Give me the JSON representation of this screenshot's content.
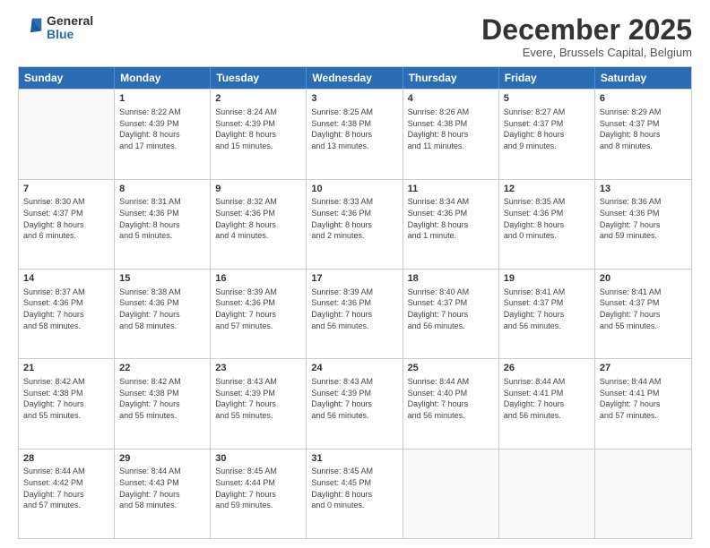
{
  "logo": {
    "general": "General",
    "blue": "Blue"
  },
  "header": {
    "month": "December 2025",
    "location": "Evere, Brussels Capital, Belgium"
  },
  "weekdays": [
    "Sunday",
    "Monday",
    "Tuesday",
    "Wednesday",
    "Thursday",
    "Friday",
    "Saturday"
  ],
  "rows": [
    [
      {
        "day": "",
        "info": ""
      },
      {
        "day": "1",
        "info": "Sunrise: 8:22 AM\nSunset: 4:39 PM\nDaylight: 8 hours\nand 17 minutes."
      },
      {
        "day": "2",
        "info": "Sunrise: 8:24 AM\nSunset: 4:39 PM\nDaylight: 8 hours\nand 15 minutes."
      },
      {
        "day": "3",
        "info": "Sunrise: 8:25 AM\nSunset: 4:38 PM\nDaylight: 8 hours\nand 13 minutes."
      },
      {
        "day": "4",
        "info": "Sunrise: 8:26 AM\nSunset: 4:38 PM\nDaylight: 8 hours\nand 11 minutes."
      },
      {
        "day": "5",
        "info": "Sunrise: 8:27 AM\nSunset: 4:37 PM\nDaylight: 8 hours\nand 9 minutes."
      },
      {
        "day": "6",
        "info": "Sunrise: 8:29 AM\nSunset: 4:37 PM\nDaylight: 8 hours\nand 8 minutes."
      }
    ],
    [
      {
        "day": "7",
        "info": "Sunrise: 8:30 AM\nSunset: 4:37 PM\nDaylight: 8 hours\nand 6 minutes."
      },
      {
        "day": "8",
        "info": "Sunrise: 8:31 AM\nSunset: 4:36 PM\nDaylight: 8 hours\nand 5 minutes."
      },
      {
        "day": "9",
        "info": "Sunrise: 8:32 AM\nSunset: 4:36 PM\nDaylight: 8 hours\nand 4 minutes."
      },
      {
        "day": "10",
        "info": "Sunrise: 8:33 AM\nSunset: 4:36 PM\nDaylight: 8 hours\nand 2 minutes."
      },
      {
        "day": "11",
        "info": "Sunrise: 8:34 AM\nSunset: 4:36 PM\nDaylight: 8 hours\nand 1 minute."
      },
      {
        "day": "12",
        "info": "Sunrise: 8:35 AM\nSunset: 4:36 PM\nDaylight: 8 hours\nand 0 minutes."
      },
      {
        "day": "13",
        "info": "Sunrise: 8:36 AM\nSunset: 4:36 PM\nDaylight: 7 hours\nand 59 minutes."
      }
    ],
    [
      {
        "day": "14",
        "info": "Sunrise: 8:37 AM\nSunset: 4:36 PM\nDaylight: 7 hours\nand 58 minutes."
      },
      {
        "day": "15",
        "info": "Sunrise: 8:38 AM\nSunset: 4:36 PM\nDaylight: 7 hours\nand 58 minutes."
      },
      {
        "day": "16",
        "info": "Sunrise: 8:39 AM\nSunset: 4:36 PM\nDaylight: 7 hours\nand 57 minutes."
      },
      {
        "day": "17",
        "info": "Sunrise: 8:39 AM\nSunset: 4:36 PM\nDaylight: 7 hours\nand 56 minutes."
      },
      {
        "day": "18",
        "info": "Sunrise: 8:40 AM\nSunset: 4:37 PM\nDaylight: 7 hours\nand 56 minutes."
      },
      {
        "day": "19",
        "info": "Sunrise: 8:41 AM\nSunset: 4:37 PM\nDaylight: 7 hours\nand 56 minutes."
      },
      {
        "day": "20",
        "info": "Sunrise: 8:41 AM\nSunset: 4:37 PM\nDaylight: 7 hours\nand 55 minutes."
      }
    ],
    [
      {
        "day": "21",
        "info": "Sunrise: 8:42 AM\nSunset: 4:38 PM\nDaylight: 7 hours\nand 55 minutes."
      },
      {
        "day": "22",
        "info": "Sunrise: 8:42 AM\nSunset: 4:38 PM\nDaylight: 7 hours\nand 55 minutes."
      },
      {
        "day": "23",
        "info": "Sunrise: 8:43 AM\nSunset: 4:39 PM\nDaylight: 7 hours\nand 55 minutes."
      },
      {
        "day": "24",
        "info": "Sunrise: 8:43 AM\nSunset: 4:39 PM\nDaylight: 7 hours\nand 56 minutes."
      },
      {
        "day": "25",
        "info": "Sunrise: 8:44 AM\nSunset: 4:40 PM\nDaylight: 7 hours\nand 56 minutes."
      },
      {
        "day": "26",
        "info": "Sunrise: 8:44 AM\nSunset: 4:41 PM\nDaylight: 7 hours\nand 56 minutes."
      },
      {
        "day": "27",
        "info": "Sunrise: 8:44 AM\nSunset: 4:41 PM\nDaylight: 7 hours\nand 57 minutes."
      }
    ],
    [
      {
        "day": "28",
        "info": "Sunrise: 8:44 AM\nSunset: 4:42 PM\nDaylight: 7 hours\nand 57 minutes."
      },
      {
        "day": "29",
        "info": "Sunrise: 8:44 AM\nSunset: 4:43 PM\nDaylight: 7 hours\nand 58 minutes."
      },
      {
        "day": "30",
        "info": "Sunrise: 8:45 AM\nSunset: 4:44 PM\nDaylight: 7 hours\nand 59 minutes."
      },
      {
        "day": "31",
        "info": "Sunrise: 8:45 AM\nSunset: 4:45 PM\nDaylight: 8 hours\nand 0 minutes."
      },
      {
        "day": "",
        "info": ""
      },
      {
        "day": "",
        "info": ""
      },
      {
        "day": "",
        "info": ""
      }
    ]
  ]
}
